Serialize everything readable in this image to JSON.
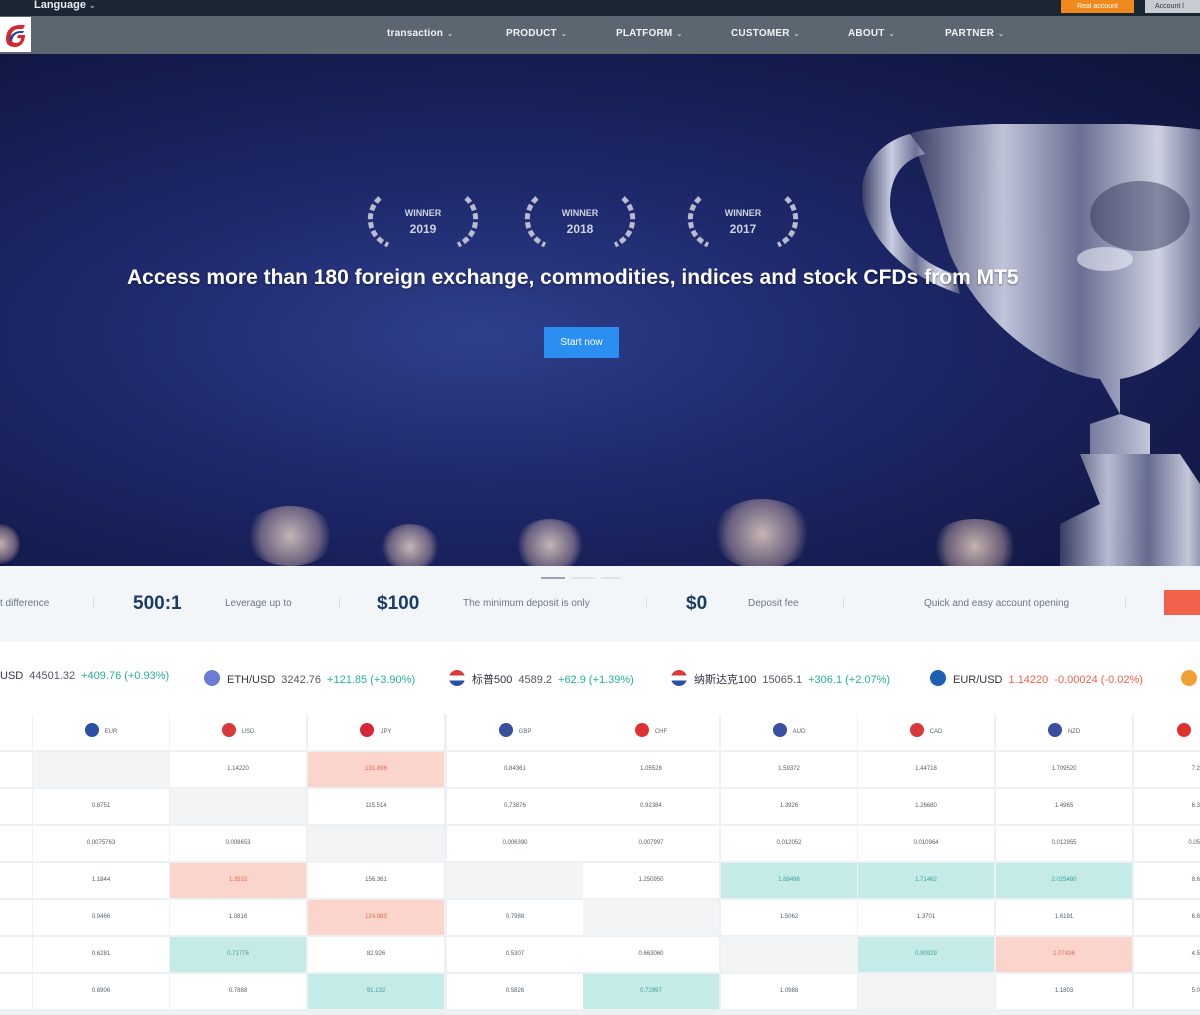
{
  "topbar": {
    "language_label": "Language",
    "real_account_label": "Real account",
    "account_label": "Account l"
  },
  "nav": {
    "items": [
      "transaction",
      "PRODUCT",
      "PLATFORM",
      "CUSTOMER",
      "ABOUT",
      "PARTNER"
    ]
  },
  "hero": {
    "awards": [
      {
        "year": "2019",
        "word": "WINNER"
      },
      {
        "year": "2018",
        "word": "WINNER"
      },
      {
        "year": "2017",
        "word": "WINNER"
      }
    ],
    "title": "Access more than 180 foreign exchange, commodities, indices and stock CFDs from MT5",
    "cta_label": "Start now"
  },
  "stats": {
    "left_cut_text": "t difference",
    "items": [
      {
        "value": "500:1",
        "label": "Leverage up to"
      },
      {
        "value": "$100",
        "label": "The minimum deposit is only"
      },
      {
        "value": "$0",
        "label": "Deposit fee"
      }
    ],
    "quick_open_text": "Quick and easy account opening"
  },
  "ticker": [
    {
      "symbol": "USD",
      "price": "44501.32",
      "change": "+409.76 (+0.93%)",
      "dir": "up"
    },
    {
      "symbol": "ETH/USD",
      "price": "3242.76",
      "change": "+121.85 (+3.90%)",
      "dir": "up"
    },
    {
      "symbol": "标普500",
      "price": "4589.2",
      "change": "+62.9 (+1.39%)",
      "dir": "up"
    },
    {
      "symbol": "纳斯达克100",
      "price": "15065.1",
      "change": "+306.1 (+2.07%)",
      "dir": "up"
    },
    {
      "symbol": "EUR/USD",
      "price": "1.14220",
      "change": "-0.00024 (-0.02%)",
      "dir": "down"
    }
  ],
  "cross_table": {
    "columns": [
      "EUR",
      "USD",
      "JPY",
      "GBP",
      "CHF",
      "AUD",
      "CAD",
      "NZD"
    ],
    "rows": [
      [
        "",
        "1.14220",
        "131.896",
        "0.84361",
        "1.05528",
        "1.59372",
        "1.44718",
        "1.709520",
        "7.2"
      ],
      [
        "0.8751",
        "",
        "115.514",
        "0.73876",
        "0.92384",
        "1.3926",
        "1.26680",
        "1.4965",
        "6.3"
      ],
      [
        "0.0075763",
        "0.008653",
        "",
        "0.006390",
        "0.007997",
        "0.012052",
        "0.010964",
        "0.012955",
        "0.05"
      ],
      [
        "1.1844",
        "1.3533",
        "156.361",
        "",
        "1.250950",
        "1.88496",
        "1.71462",
        "2.025480",
        "8.6"
      ],
      [
        "0.9466",
        "1.0816",
        "124.983",
        "0.7988",
        "",
        "1.5062",
        "1.3701",
        "1.6191",
        "6.8"
      ],
      [
        "0.6281",
        "0.71776",
        "82.926",
        "0.5307",
        "0.663060",
        "",
        "0.90929",
        "1.07436",
        "4.5"
      ],
      [
        "0.6906",
        "0.7888",
        "91.132",
        "0.5826",
        "0.72997",
        "1.0988",
        "",
        "1.1803",
        "5.0"
      ]
    ]
  },
  "colors": {
    "up": "#26b19a",
    "down": "#f0604a",
    "start_button": "#2a8ff0",
    "real_account_button": "#f08a1d"
  }
}
